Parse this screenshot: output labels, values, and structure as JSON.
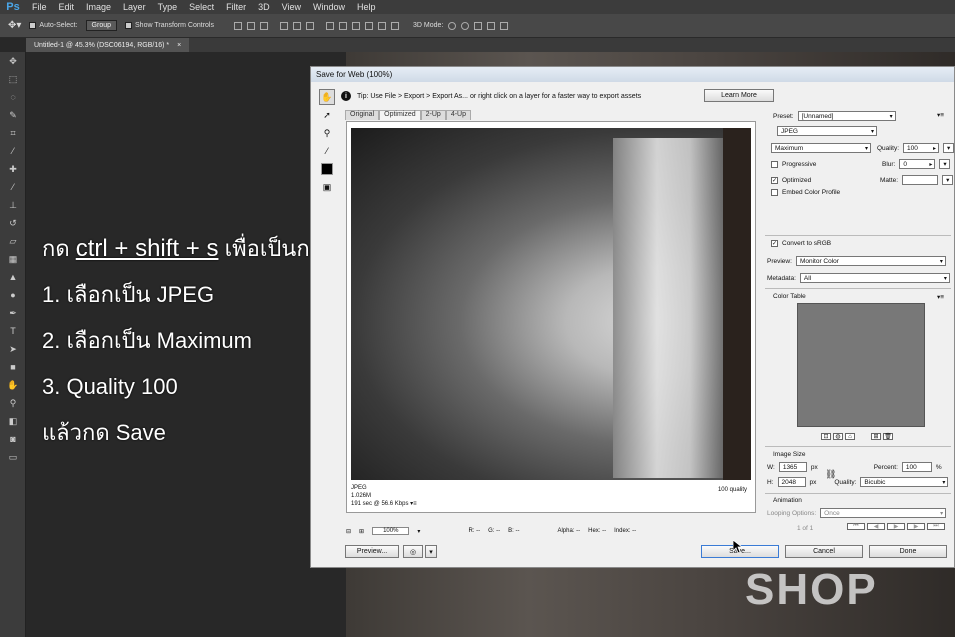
{
  "app": {
    "logo": "Ps"
  },
  "menu": [
    "File",
    "Edit",
    "Image",
    "Layer",
    "Type",
    "Select",
    "Filter",
    "3D",
    "View",
    "Window",
    "Help"
  ],
  "options_bar": {
    "auto_select_label": "Auto-Select:",
    "auto_select_value": "Group",
    "show_transform_label": "Show Transform Controls",
    "mode3d": "3D Mode:"
  },
  "doc_tab": {
    "title": "Untitled-1 @ 45.3% (DSC06194, RGB/16) *",
    "close": "×"
  },
  "overlay_text": {
    "line1_prefix": "กด",
    "line1_keys": "ctrl  + shift + s",
    "line1_suffix": "เพื่อเป็นการ Save for web",
    "step1": "1. เลือกเป็น JPEG",
    "step2": "2. เลือกเป็น Maximum",
    "step3": "3. Quality 100",
    "step4": "แล้วกด Save"
  },
  "dialog": {
    "title": "Save for Web (100%)",
    "tip": "Tip: Use File > Export > Export As...  or right click on a layer for a faster way to export assets",
    "learn_more": "Learn More",
    "tabs": [
      "Original",
      "Optimized",
      "2-Up",
      "4-Up"
    ],
    "preview_info": {
      "format": "JPEG",
      "size": "1.026M",
      "time": "191 sec @ 56.6 Kbps",
      "menu": "▾≡",
      "quality": "100 quality"
    },
    "status": {
      "zoom": "100%",
      "r": "R: --",
      "g": "G: --",
      "b": "B: --",
      "alpha": "Alpha: --",
      "hex": "Hex: --",
      "index": "Index: --"
    },
    "buttons": {
      "preview": "Preview...",
      "save": "Save...",
      "cancel": "Cancel",
      "done": "Done"
    },
    "settings": {
      "preset_label": "Preset:",
      "preset_value": "[Unnamed]",
      "format_value": "JPEG",
      "compression_value": "Maximum",
      "quality_label": "Quality:",
      "quality_value": "100",
      "progressive_label": "Progressive",
      "progressive_checked": false,
      "blur_label": "Blur:",
      "blur_value": "0",
      "optimized_label": "Optimized",
      "optimized_checked": true,
      "matte_label": "Matte:",
      "matte_value": "",
      "embed_label": "Embed Color Profile",
      "embed_checked": false,
      "convert_label": "Convert to sRGB",
      "convert_checked": true,
      "preview_label": "Preview:",
      "preview_value": "Monitor Color",
      "metadata_label": "Metadata:",
      "metadata_value": "All",
      "color_table_label": "Color Table",
      "image_size_label": "Image Size",
      "w_label": "W:",
      "w_value": "1365",
      "h_label": "H:",
      "h_value": "2048",
      "px": "px",
      "percent_label": "Percent:",
      "percent_value": "100",
      "percent_unit": "%",
      "quality2_label": "Quality:",
      "quality2_value": "Bicubic",
      "animation_label": "Animation",
      "looping_label": "Looping Options:",
      "looping_value": "Once",
      "frame_counter": "1 of 1"
    }
  },
  "watermark": "SHOP"
}
